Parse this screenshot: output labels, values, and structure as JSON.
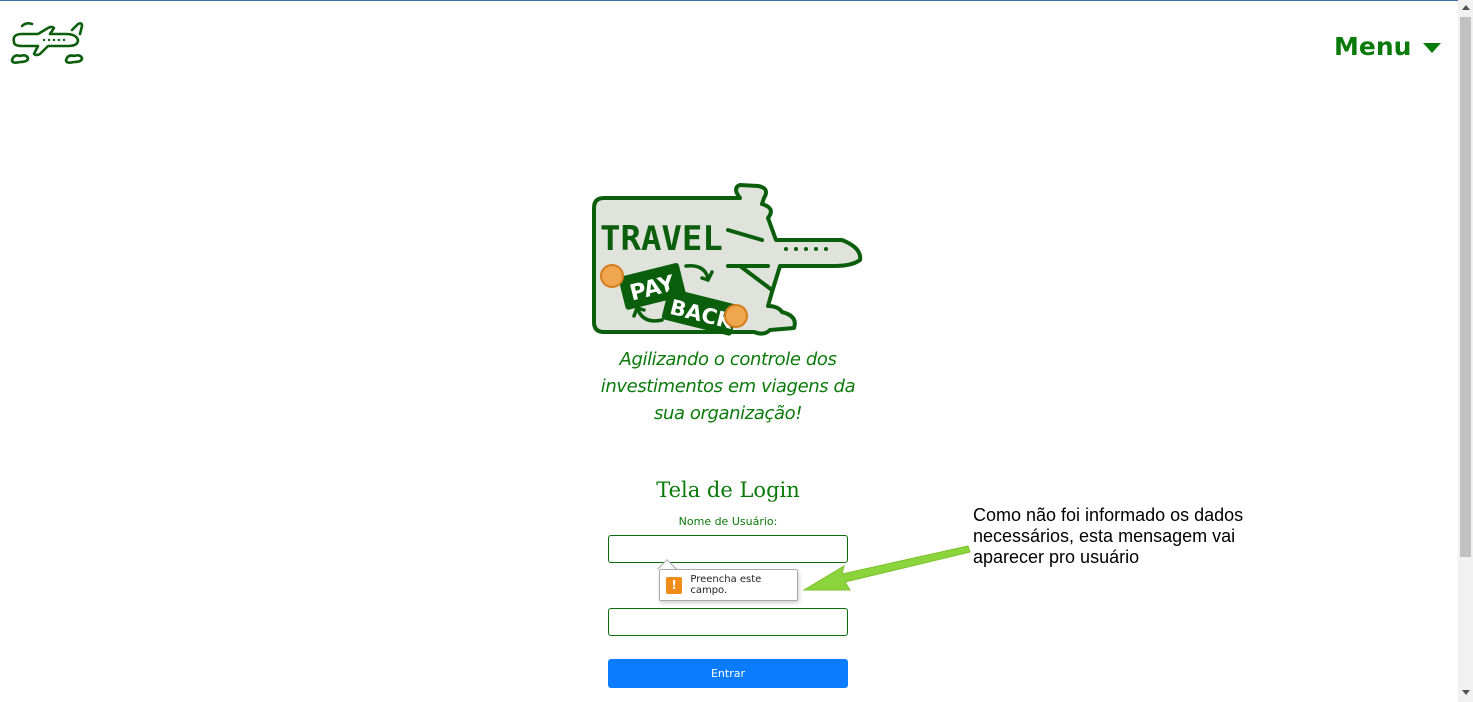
{
  "header": {
    "logo_icon": "airplane-icon",
    "menu_label": "Menu",
    "menu_icon": "caret-down-icon"
  },
  "brand": {
    "logo_word_1": "TRAVEL",
    "logo_word_2": "PAY",
    "logo_word_3": "BACK",
    "tagline": "Agilizando o controle dos investimentos em viagens da sua organização!"
  },
  "login": {
    "title": "Tela de Login",
    "username_label": "Nome de Usuário:",
    "username_value": "",
    "password_value": "",
    "validation_message": "Preencha este campo.",
    "validation_icon": "warning-icon",
    "submit_label": "Entrar"
  },
  "annotation": {
    "text": "Como não foi informado os dados necessários, esta mensagem vai aparecer pro usuário"
  },
  "colors": {
    "brand_green": "#0a7a0a",
    "logo_green": "#0b5e0b",
    "button_blue": "#0b7cff",
    "arrow_green": "#8cd43c",
    "warning_orange": "#f28c18"
  }
}
